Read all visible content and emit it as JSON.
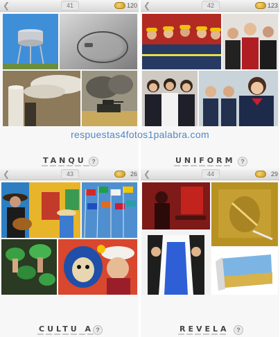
{
  "watermark": "respuestas4fotos1palabra.com",
  "icons": {
    "back": "back-arrow-icon",
    "coin": "coin-stack-icon",
    "hint": "help-icon"
  },
  "colors": {
    "watermark": "#4f86c6",
    "panel_bg": "#f7f7f7"
  },
  "panels": [
    {
      "level": "41",
      "coins": "120",
      "answer": "TANQU",
      "hint": "?"
    },
    {
      "level": "42",
      "coins": "123",
      "answer": "UNIFORM",
      "hint": "?"
    },
    {
      "level": "43",
      "coins": "26",
      "answer": "CULTU A",
      "hint": "?"
    },
    {
      "level": "44",
      "coins": "29",
      "answer": "REVELA",
      "hint": "?"
    }
  ]
}
